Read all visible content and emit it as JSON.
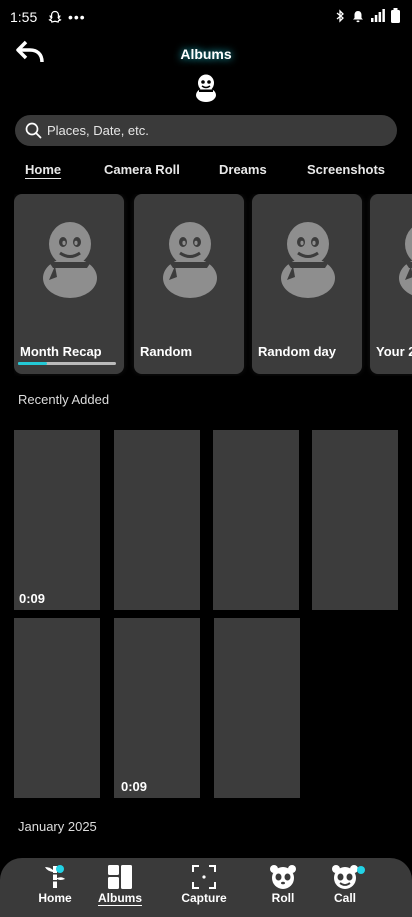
{
  "status": {
    "time": "1:55",
    "dots": "•••"
  },
  "header": {
    "title": "Albums"
  },
  "search": {
    "placeholder": "Places, Date, etc."
  },
  "tabs": [
    {
      "label": "Home",
      "active": true
    },
    {
      "label": "Camera Roll",
      "active": false
    },
    {
      "label": "Dreams",
      "active": false
    },
    {
      "label": "Screenshots",
      "active": false
    }
  ],
  "cards": [
    {
      "label": "Month Recap",
      "progress": 0.3
    },
    {
      "label": "Random"
    },
    {
      "label": "Random day"
    },
    {
      "label": "Your 2"
    }
  ],
  "recent": {
    "title": "Recently Added",
    "thumbs": [
      {
        "duration": "0:09"
      },
      {
        "duration": ""
      },
      {
        "duration": ""
      },
      {
        "duration": ""
      },
      {
        "duration": ""
      },
      {
        "duration": "0:09"
      },
      {
        "duration": ""
      }
    ]
  },
  "section2": {
    "title": "January 2025"
  },
  "nav": [
    {
      "label": "Home",
      "icon": "bamboo-icon",
      "badge": true
    },
    {
      "label": "Albums",
      "icon": "albums-grid-icon",
      "active": true
    },
    {
      "label": "Capture",
      "icon": "capture-frame-icon"
    },
    {
      "label": "Roll",
      "icon": "panda-icon"
    },
    {
      "label": "Call",
      "icon": "panda-call-icon",
      "badge": true
    }
  ],
  "colors": {
    "accent": "#24c9d6",
    "card": "#3c3c3c",
    "nav": "#3a3a3a"
  }
}
